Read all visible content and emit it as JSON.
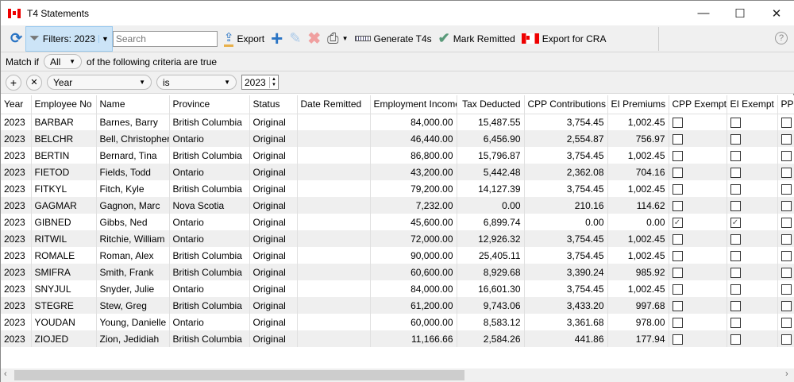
{
  "window": {
    "title": "T4 Statements",
    "minimize": "—",
    "maximize": "☐",
    "close": "✕"
  },
  "toolbar": {
    "filters": "Filters: 2023",
    "search_placeholder": "Search",
    "export": "Export",
    "generate": "Generate T4s",
    "mark_remitted": "Mark Remitted",
    "export_cra": "Export for CRA",
    "help": "?"
  },
  "match": {
    "prefix": "Match if",
    "value": "All",
    "suffix": "of the following criteria are true"
  },
  "criteria": {
    "field": "Year",
    "operator": "is",
    "value": "2023"
  },
  "columns": [
    "Year",
    "Employee No",
    "Name",
    "Province",
    "Status",
    "Date Remitted",
    "Employment Income",
    "Tax Deducted",
    "CPP Contributions",
    "EI Premiums",
    "CPP Exempt",
    "EI Exempt",
    "PPI"
  ],
  "rows": [
    [
      "2023",
      "BARBAR",
      "Barnes, Barry",
      "British Columbia",
      "Original",
      "",
      "84,000.00",
      "15,487.55",
      "3,754.45",
      "1,002.45",
      false,
      false,
      false
    ],
    [
      "2023",
      "BELCHR",
      "Bell, Christopher",
      "Ontario",
      "Original",
      "",
      "46,440.00",
      "6,456.90",
      "2,554.87",
      "756.97",
      false,
      false,
      false
    ],
    [
      "2023",
      "BERTIN",
      "Bernard, Tina",
      "British Columbia",
      "Original",
      "",
      "86,800.00",
      "15,796.87",
      "3,754.45",
      "1,002.45",
      false,
      false,
      false
    ],
    [
      "2023",
      "FIETOD",
      "Fields, Todd",
      "Ontario",
      "Original",
      "",
      "43,200.00",
      "5,442.48",
      "2,362.08",
      "704.16",
      false,
      false,
      false
    ],
    [
      "2023",
      "FITKYL",
      "Fitch, Kyle",
      "British Columbia",
      "Original",
      "",
      "79,200.00",
      "14,127.39",
      "3,754.45",
      "1,002.45",
      false,
      false,
      false
    ],
    [
      "2023",
      "GAGMAR",
      "Gagnon, Marc",
      "Nova Scotia",
      "Original",
      "",
      "7,232.00",
      "0.00",
      "210.16",
      "114.62",
      false,
      false,
      false
    ],
    [
      "2023",
      "GIBNED",
      "Gibbs, Ned",
      "Ontario",
      "Original",
      "",
      "45,600.00",
      "6,899.74",
      "0.00",
      "0.00",
      true,
      true,
      false
    ],
    [
      "2023",
      "RITWIL",
      "Ritchie, William",
      "Ontario",
      "Original",
      "",
      "72,000.00",
      "12,926.32",
      "3,754.45",
      "1,002.45",
      false,
      false,
      false
    ],
    [
      "2023",
      "ROMALE",
      "Roman, Alex",
      "British Columbia",
      "Original",
      "",
      "90,000.00",
      "25,405.11",
      "3,754.45",
      "1,002.45",
      false,
      false,
      false
    ],
    [
      "2023",
      "SMIFRA",
      "Smith, Frank",
      "British Columbia",
      "Original",
      "",
      "60,600.00",
      "8,929.68",
      "3,390.24",
      "985.92",
      false,
      false,
      false
    ],
    [
      "2023",
      "SNYJUL",
      "Snyder, Julie",
      "Ontario",
      "Original",
      "",
      "84,000.00",
      "16,601.30",
      "3,754.45",
      "1,002.45",
      false,
      false,
      false
    ],
    [
      "2023",
      "STEGRE",
      "Stew, Greg",
      "British Columbia",
      "Original",
      "",
      "61,200.00",
      "9,743.06",
      "3,433.20",
      "997.68",
      false,
      false,
      false
    ],
    [
      "2023",
      "YOUDAN",
      "Young, Danielle",
      "Ontario",
      "Original",
      "",
      "60,000.00",
      "8,583.12",
      "3,361.68",
      "978.00",
      false,
      false,
      false
    ],
    [
      "2023",
      "ZIOJED",
      "Zion, Jedidiah",
      "British Columbia",
      "Original",
      "",
      "11,166.66",
      "2,584.26",
      "441.86",
      "177.94",
      false,
      false,
      false
    ]
  ]
}
